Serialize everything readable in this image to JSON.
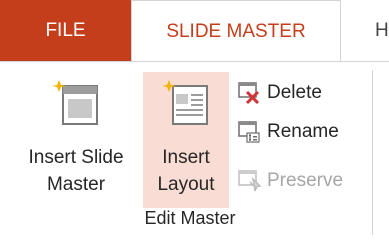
{
  "tabs": {
    "file": "FILE",
    "active": "SLIDE MASTER",
    "next_partial": "H"
  },
  "edit_master_group": {
    "label": "Edit Master",
    "insert_slide_master": {
      "line1": "Insert Slide",
      "line2": "Master",
      "icon": "slide-master-sparkle-icon"
    },
    "insert_layout": {
      "line1": "Insert",
      "line2": "Layout",
      "icon": "layout-sparkle-icon"
    },
    "delete": {
      "label": "Delete",
      "icon": "delete-slide-icon"
    },
    "rename": {
      "label": "Rename",
      "icon": "rename-slide-icon"
    },
    "preserve": {
      "label": "Preserve",
      "icon": "preserve-pin-icon",
      "enabled": false
    }
  },
  "colors": {
    "file_tab_bg": "#c43e1c",
    "active_tab_text": "#c43e1c",
    "hover_highlight": "#f9dcd3",
    "disabled_text": "#a6a6a6"
  }
}
